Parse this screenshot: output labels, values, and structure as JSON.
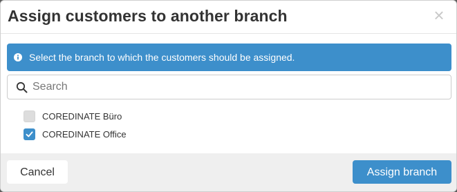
{
  "dialog": {
    "title": "Assign customers to another branch",
    "close_symbol": "×"
  },
  "alert": {
    "icon": "info-circle-icon",
    "message": "Select the branch to which the customers should be assigned."
  },
  "search": {
    "icon": "search-icon",
    "placeholder": "Search",
    "value": ""
  },
  "branches": [
    {
      "label": "COREDINATE Büro",
      "checked": false
    },
    {
      "label": "COREDINATE Office",
      "checked": true
    }
  ],
  "footer": {
    "cancel_label": "Cancel",
    "assign_label": "Assign branch"
  },
  "colors": {
    "primary": "#3d8fcb",
    "footer_bg": "#efefef",
    "title_text": "#333333"
  }
}
